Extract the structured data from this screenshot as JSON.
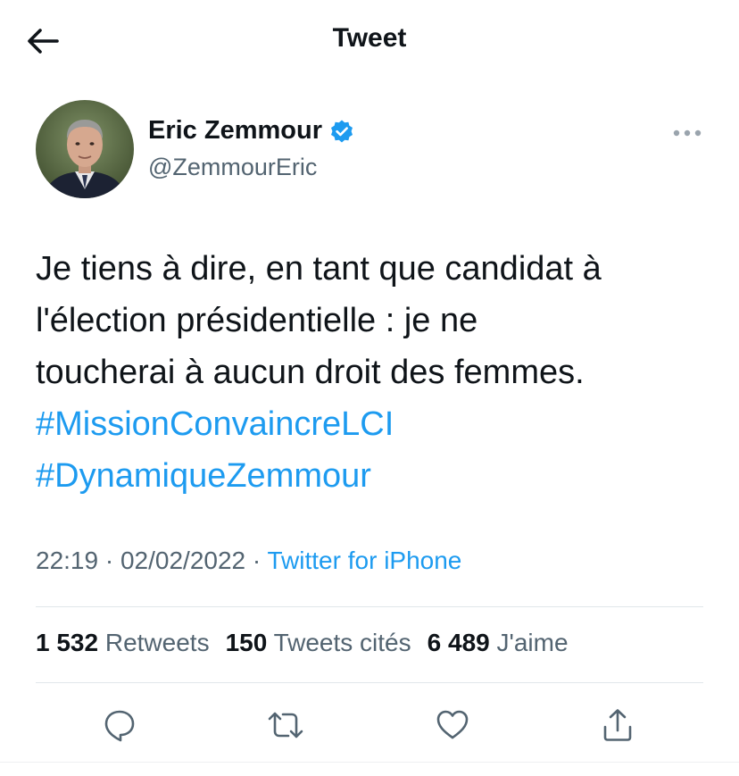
{
  "header": {
    "title": "Tweet",
    "back_icon": "arrow-left-icon"
  },
  "author": {
    "name": "Eric Zemmour",
    "handle": "@ZemmourEric",
    "verified": true,
    "verified_color": "#1d9bf0"
  },
  "tweet": {
    "text_lines": [
      "Je tiens à dire, en tant que candidat à",
      "l'élection présidentielle : je ne",
      "toucherai à aucun droit des femmes."
    ],
    "hashtags": [
      "#MissionConvaincreLCI",
      "#DynamiqueZemmour"
    ],
    "time": "22:19",
    "date": "02/02/2022",
    "separator": "·",
    "source": "Twitter for iPhone"
  },
  "stats": {
    "retweets": {
      "count": "1 532",
      "label": "Retweets"
    },
    "quotes": {
      "count": "150",
      "label": "Tweets cités"
    },
    "likes": {
      "count": "6 489",
      "label": "J'aime"
    }
  },
  "actions": [
    "reply-icon",
    "retweet-icon",
    "like-icon",
    "share-icon"
  ],
  "colors": {
    "accent": "#1d9bf0",
    "text": "#0f1419",
    "secondary": "#536471"
  }
}
